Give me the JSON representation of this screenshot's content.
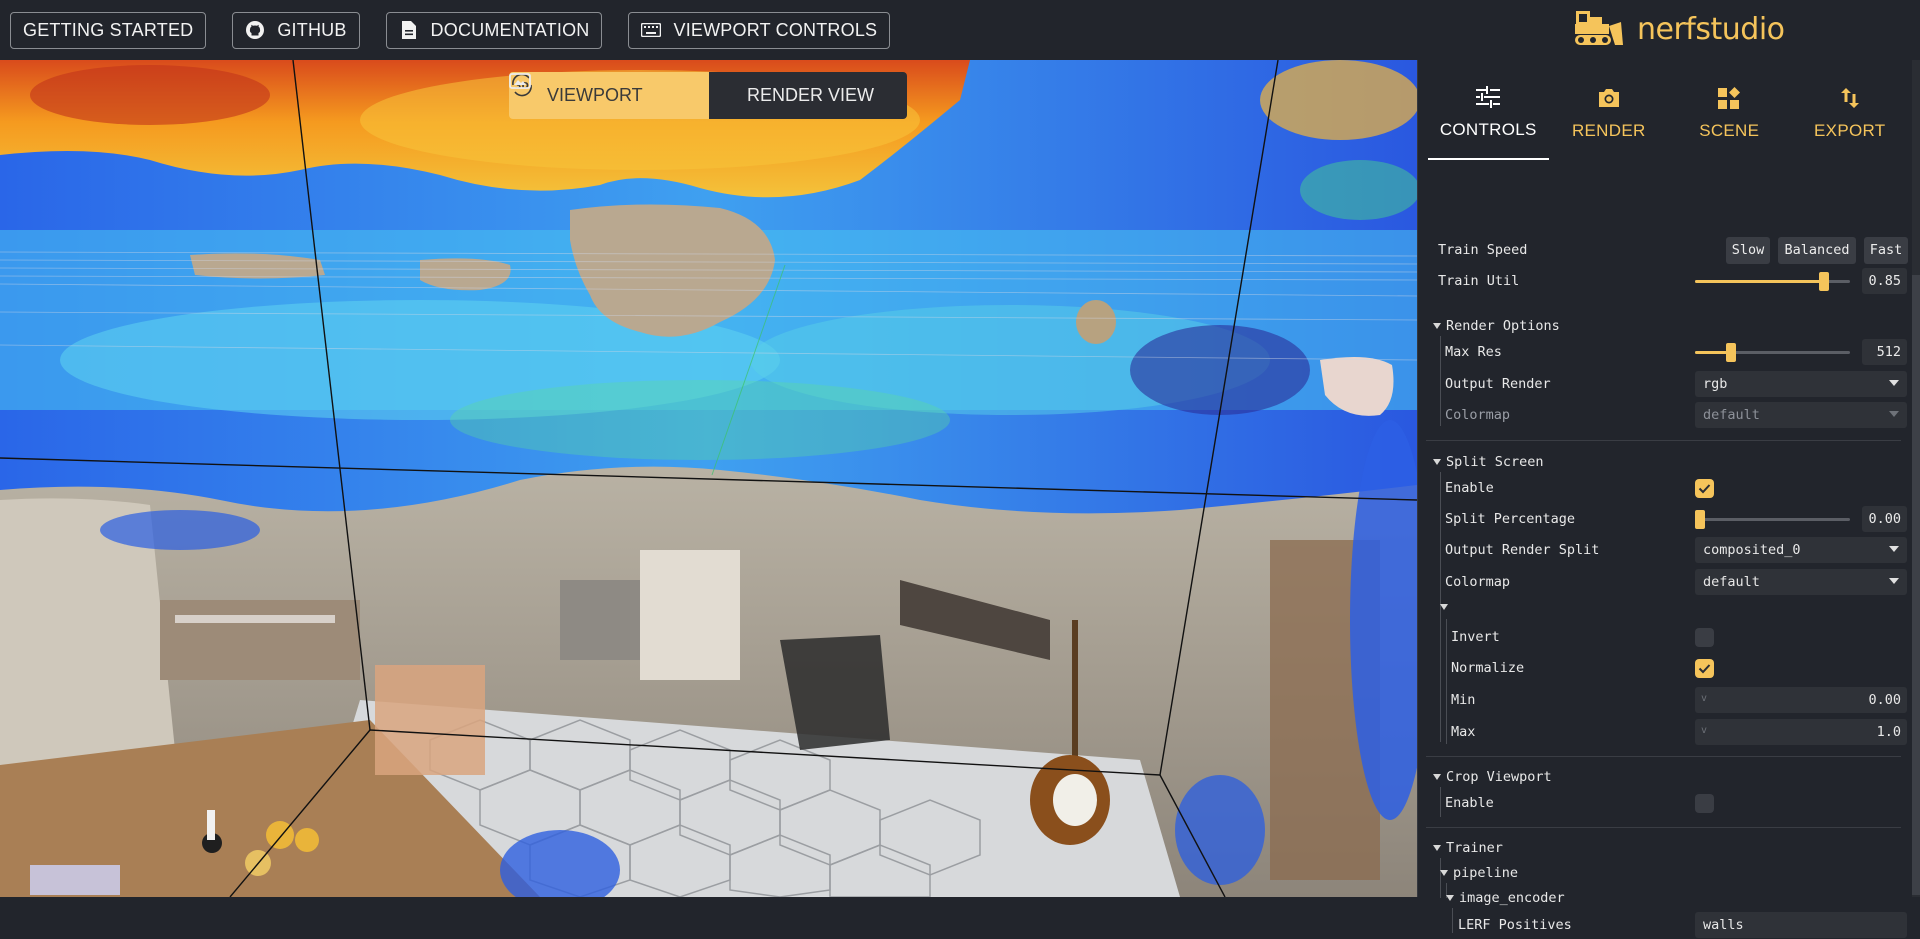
{
  "topbar": {
    "buttons": [
      {
        "label": "GETTING STARTED",
        "icon": "none"
      },
      {
        "label": "GITHUB",
        "icon": "github-icon"
      },
      {
        "label": "DOCUMENTATION",
        "icon": "document-icon"
      },
      {
        "label": "VIEWPORT CONTROLS",
        "icon": "keyboard-icon"
      }
    ],
    "logo_text": "nerfstudio"
  },
  "viewport": {
    "toggle_active": "VIEWPORT",
    "toggle_inactive": "RENDER VIEW",
    "active_badge": "3D"
  },
  "panel": {
    "tabs": [
      {
        "label": "CONTROLS",
        "icon": "sliders-icon",
        "active": true
      },
      {
        "label": "RENDER",
        "icon": "camera-icon",
        "active": false
      },
      {
        "label": "SCENE",
        "icon": "widgets-icon",
        "active": false
      },
      {
        "label": "EXPORT",
        "icon": "swap-vertical-icon",
        "active": false
      }
    ],
    "train_speed": {
      "label": "Train Speed",
      "options": [
        "Slow",
        "Balanced",
        "Fast"
      ]
    },
    "train_util": {
      "label": "Train Util",
      "value": "0.85",
      "level": 0.85
    },
    "render_options": {
      "title": "Render Options",
      "max_res": {
        "label": "Max Res",
        "value": "512",
        "level": 0.2
      },
      "output_render": {
        "label": "Output Render",
        "value": "rgb"
      },
      "colormap": {
        "label": "Colormap",
        "value": "default"
      }
    },
    "split_screen": {
      "title": "Split Screen",
      "enable": {
        "label": "Enable",
        "checked": true
      },
      "split_percentage": {
        "label": "Split Percentage",
        "value": "0.00",
        "level": 0.0
      },
      "output_render_split": {
        "label": "Output Render Split",
        "value": "composited_0"
      },
      "colormap": {
        "label": "Colormap",
        "value": "default"
      },
      "invert": {
        "label": "Invert",
        "checked": false
      },
      "normalize": {
        "label": "Normalize",
        "checked": true
      },
      "min": {
        "label": "Min",
        "value": "0.00",
        "prefix": "v"
      },
      "max": {
        "label": "Max",
        "value": "1.0",
        "prefix": "v"
      }
    },
    "crop_viewport": {
      "title": "Crop Viewport",
      "enable": {
        "label": "Enable",
        "checked": false
      }
    },
    "trainer": {
      "title": "Trainer",
      "pipeline": "pipeline",
      "image_encoder": "image_encoder",
      "lerf_positives": {
        "label": "LERF Positives",
        "value": "walls"
      }
    }
  },
  "colors": {
    "accent": "#f5c45b",
    "background": "#22252c",
    "control": "#2f3238"
  }
}
